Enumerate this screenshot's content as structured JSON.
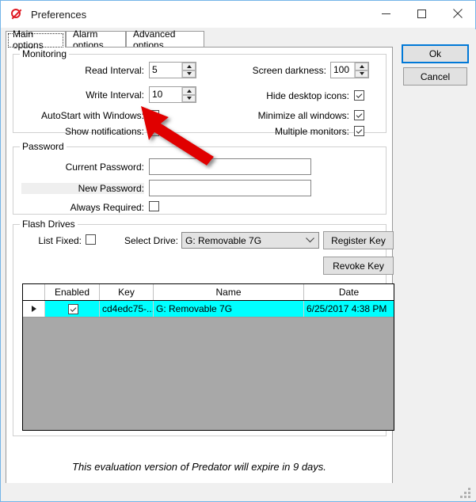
{
  "window": {
    "title": "Preferences",
    "icon": "prohibited-icon",
    "controls": {
      "minimize": "minimize-icon",
      "maximize": "maximize-icon",
      "close": "close-icon"
    }
  },
  "tabs": [
    {
      "label": "Main options",
      "selected": true
    },
    {
      "label": "Alarm options",
      "selected": false
    },
    {
      "label": "Advanced options",
      "selected": false
    }
  ],
  "monitoring": {
    "group_label": "Monitoring",
    "read_interval": {
      "label": "Read Interval:",
      "value": "5"
    },
    "write_interval": {
      "label": "Write Interval:",
      "value": "10"
    },
    "autostart": {
      "label": "AutoStart with Windows:",
      "checked": false
    },
    "show_notifications": {
      "label": "Show notifications:",
      "checked": true
    },
    "screen_darkness": {
      "label": "Screen darkness:",
      "value": "100"
    },
    "hide_desktop_icons": {
      "label": "Hide desktop icons:",
      "checked": true
    },
    "minimize_all_windows": {
      "label": "Minimize all windows:",
      "checked": true
    },
    "multiple_monitors": {
      "label": "Multiple monitors:",
      "checked": true
    }
  },
  "password": {
    "group_label": "Password",
    "current_password": {
      "label": "Current Password:",
      "value": "",
      "placeholder": ""
    },
    "new_password": {
      "label": "New Password:",
      "value": "",
      "placeholder": ""
    },
    "always_required": {
      "label": "Always Required:",
      "checked": false
    }
  },
  "flash_drives": {
    "group_label": "Flash Drives",
    "list_fixed": {
      "label": "List Fixed:",
      "checked": false
    },
    "select_drive": {
      "label": "Select Drive:",
      "value": "G: Removable 7G",
      "arrow": "chevron-down-icon"
    },
    "register_key_label": "Register Key",
    "revoke_key_label": "Revoke Key",
    "table": {
      "headers": [
        "",
        "Enabled",
        "Key",
        "Name",
        "Date"
      ],
      "rows": [
        {
          "selector": "row-selector-icon",
          "enabled": true,
          "key": "cd4edc75-...",
          "name": "G: Removable 7G",
          "date": "6/25/2017 4:38 PM",
          "selected": true
        }
      ]
    }
  },
  "footer": {
    "text": "This evaluation version of Predator will expire in 9 days."
  },
  "buttons": {
    "ok": "Ok",
    "cancel": "Cancel"
  },
  "colors": {
    "accent": "#0078d7",
    "selected_row": "#00ffff",
    "grid_background": "#a8a8a8",
    "annotation_arrow": "#e00000",
    "window_border": "#74b5e8"
  }
}
